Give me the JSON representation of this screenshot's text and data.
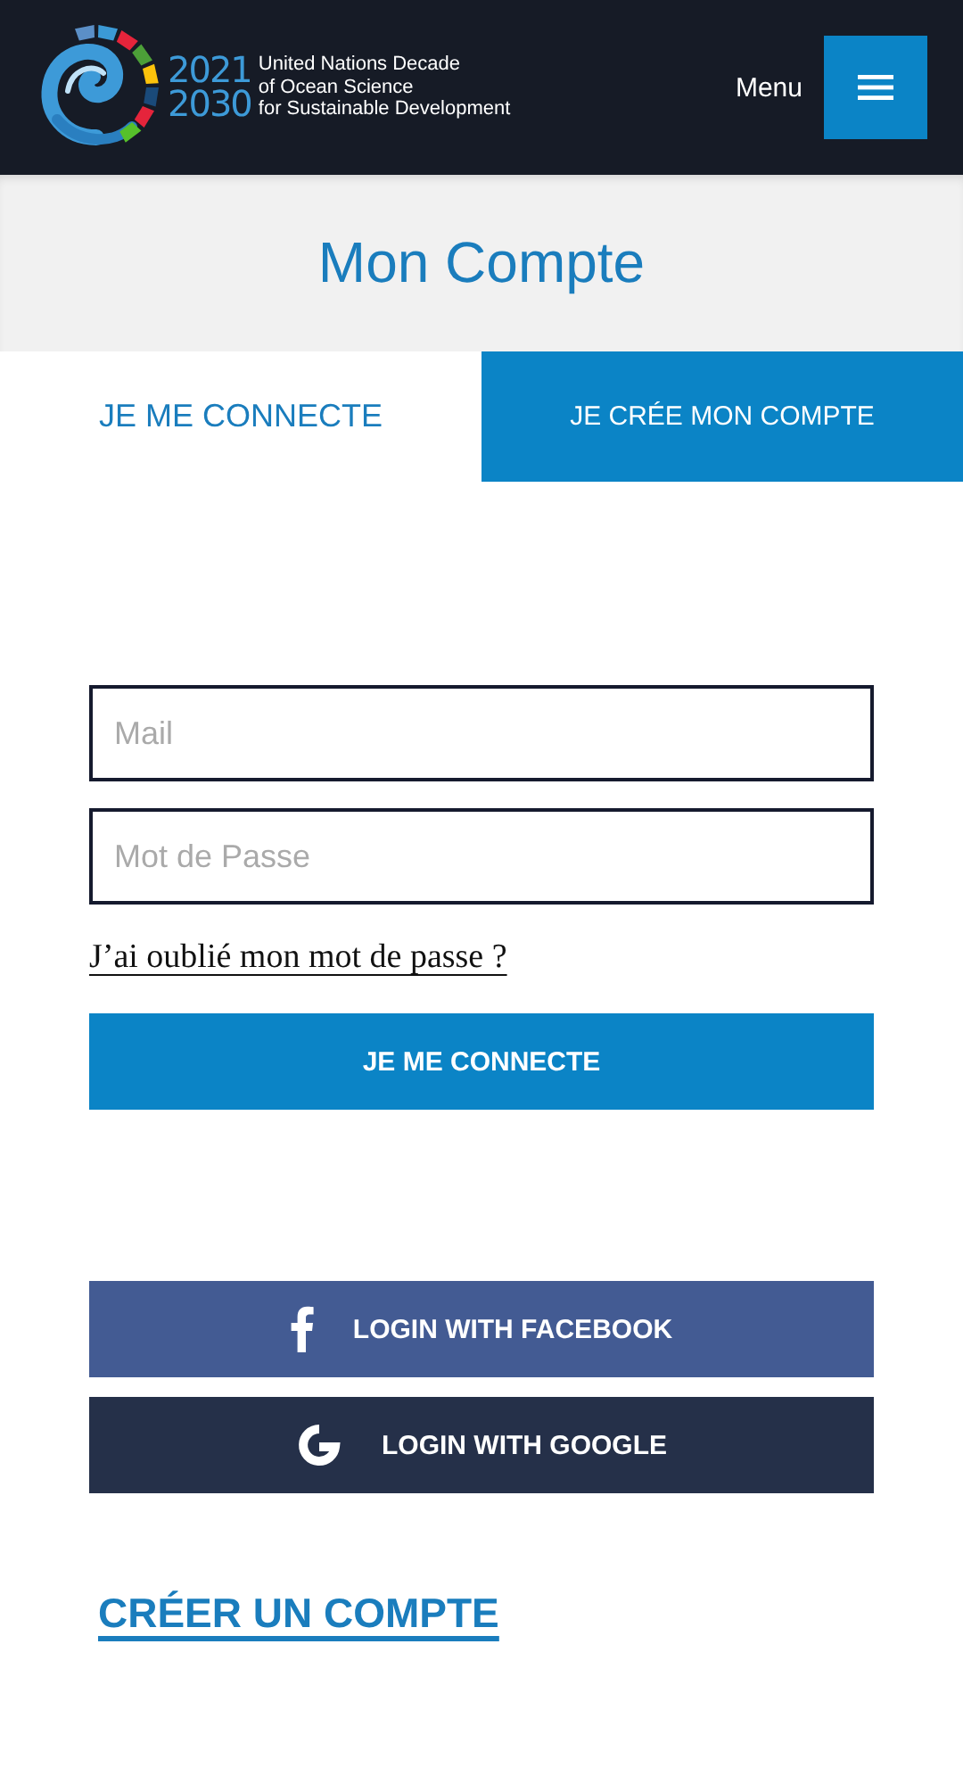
{
  "header": {
    "logo_years": [
      "2021",
      "2030"
    ],
    "logo_lines": [
      "United Nations Decade",
      "of Ocean Science",
      "for Sustainable Development"
    ],
    "menu_label": "Menu"
  },
  "page_title": "Mon Compte",
  "tabs": [
    {
      "label": "JE ME CONNECTE",
      "selected": true
    },
    {
      "label": "JE CRÉE MON COMPTE",
      "selected": false
    }
  ],
  "fields": [
    {
      "placeholder": "Mail"
    },
    {
      "placeholder": "Mot de Passe"
    }
  ],
  "forgot_link": "J’ai oublié mon mot de passe ?",
  "submit_button": "JE ME CONNECTE",
  "social_buttons": [
    {
      "kind": "facebook",
      "label": "LOGIN WITH FACEBOOK"
    },
    {
      "kind": "google",
      "label": "LOGIN WITH GOOGLE"
    }
  ],
  "create_link": "CRÉER UN COMPTE"
}
